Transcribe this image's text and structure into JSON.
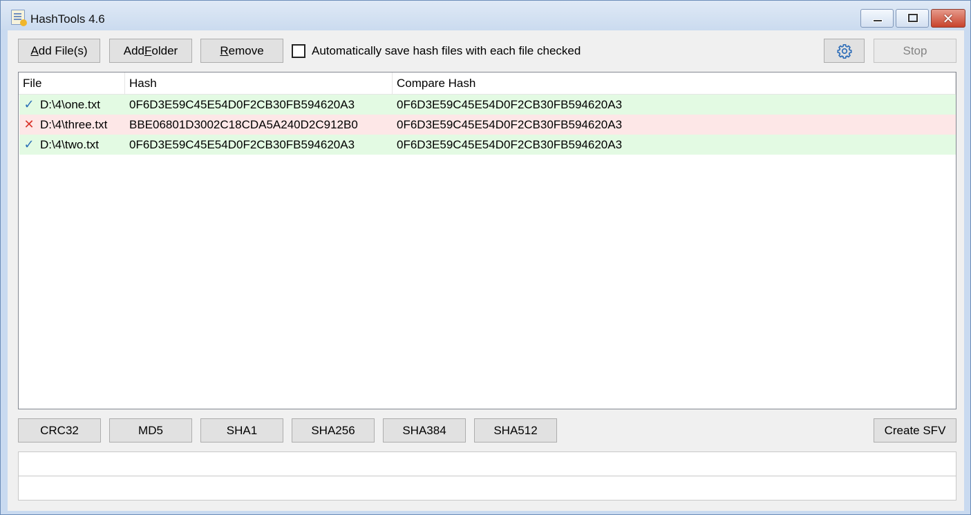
{
  "window": {
    "title": "HashTools 4.6",
    "close_glyph": "✕"
  },
  "toolbar": {
    "add_files": {
      "pre": "",
      "u": "A",
      "post": "dd File(s)"
    },
    "add_folder": {
      "pre": "Add ",
      "u": "F",
      "post": "older"
    },
    "remove": {
      "pre": "",
      "u": "R",
      "post": "emove"
    },
    "auto_save_label": "Automatically save hash files with each file checked",
    "auto_save_checked": false,
    "settings_icon": "gear-icon",
    "stop_label": "Stop"
  },
  "list": {
    "columns": [
      "File",
      "Hash",
      "Compare Hash"
    ],
    "rows": [
      {
        "status": "ok",
        "icon": "✓",
        "file": "D:\\4\\one.txt",
        "hash": "0F6D3E59C45E54D0F2CB30FB594620A3",
        "compare": "0F6D3E59C45E54D0F2CB30FB594620A3"
      },
      {
        "status": "bad",
        "icon": "✕",
        "file": "D:\\4\\three.txt",
        "hash": "BBE06801D3002C18CDA5A240D2C912B0",
        "compare": "0F6D3E59C45E54D0F2CB30FB594620A3"
      },
      {
        "status": "ok",
        "icon": "✓",
        "file": "D:\\4\\two.txt",
        "hash": "0F6D3E59C45E54D0F2CB30FB594620A3",
        "compare": "0F6D3E59C45E54D0F2CB30FB594620A3"
      }
    ]
  },
  "hash_buttons": [
    "CRC32",
    "MD5",
    "SHA1",
    "SHA256",
    "SHA384",
    "SHA512"
  ],
  "create_sfv_label": "Create SFV",
  "colors": {
    "row_ok": "#e3fae3",
    "row_bad": "#fde7e7",
    "check_icon": "#2b6fb6",
    "cross_icon": "#d9342b"
  }
}
